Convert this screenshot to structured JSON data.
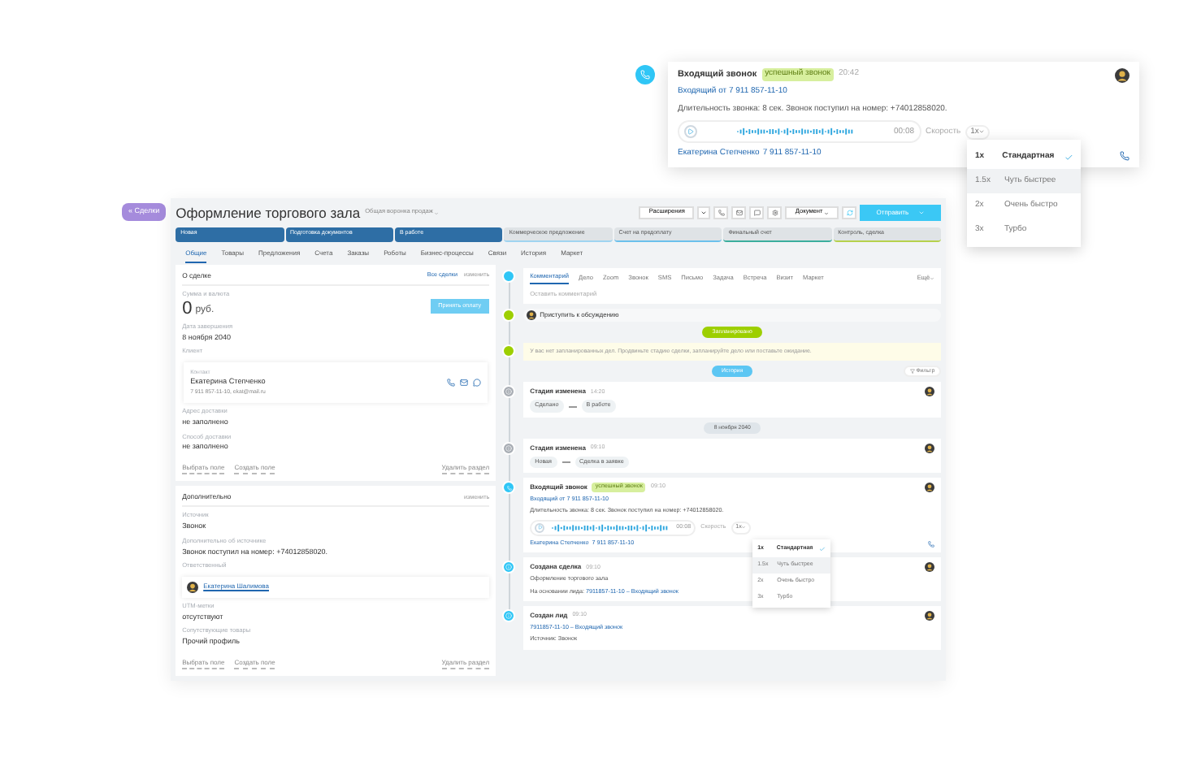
{
  "call_popup": {
    "title": "Входящий звонок",
    "badge": "успешный звонок",
    "time": "20:42",
    "link": "Входящий от 7 911 857-11-10",
    "details": "Длительность звонка: 8 сек. Звонок поступил на номер: +74012858020.",
    "duration": "00:08",
    "speed_label": "Скорость",
    "speed_value": "1x",
    "contact": "Екатерина Степченко",
    "phone": "7 911 857-11-10",
    "speed_menu": [
      {
        "rate": "1x",
        "label": "Стандартная",
        "selected": true,
        "highlighted": false
      },
      {
        "rate": "1.5x",
        "label": "Чуть быстрее",
        "selected": false,
        "highlighted": true
      },
      {
        "rate": "2x",
        "label": "Очень быстро",
        "selected": false,
        "highlighted": false
      },
      {
        "rate": "3x",
        "label": "Турбо",
        "selected": false,
        "highlighted": false
      }
    ]
  },
  "deal": {
    "back": "« Сделки",
    "title": "Оформление торгового зала",
    "funnel": "Общая воронка продаж",
    "toolbar": {
      "extensions": "Расширения",
      "document": "Документ",
      "primary": "Отправить"
    },
    "stages": [
      {
        "label": "Новая",
        "done": true,
        "color": "#2e6ea5"
      },
      {
        "label": "Подготовка документов",
        "done": true,
        "color": "#2e6ea5"
      },
      {
        "label": "В работе",
        "done": true,
        "color": "#2e6ea5"
      },
      {
        "label": "Коммерческое предложение",
        "done": false,
        "color": "#9fd4f0"
      },
      {
        "label": "Счет на предоплату",
        "done": false,
        "color": "#6cc0ec"
      },
      {
        "label": "Финальный счет",
        "done": false,
        "color": "#3cae9d"
      },
      {
        "label": "Контроль, сделка",
        "done": false,
        "color": "#b6d14c"
      }
    ],
    "tabs": [
      {
        "label": "Общие",
        "selected": true
      },
      {
        "label": "Товары",
        "selected": false
      },
      {
        "label": "Предложения",
        "selected": false
      },
      {
        "label": "Счета",
        "selected": false
      },
      {
        "label": "Заказы",
        "selected": false
      },
      {
        "label": "Роботы",
        "selected": false
      },
      {
        "label": "Бизнес-процессы",
        "selected": false
      },
      {
        "label": "Связи",
        "selected": false
      },
      {
        "label": "История",
        "selected": false
      },
      {
        "label": "Маркет",
        "selected": false
      }
    ],
    "about": {
      "title": "О сделке",
      "all_deals": "Все сделки",
      "edit": "изменить",
      "amount_label": "Сумма и валюта",
      "amount": "0",
      "currency": "руб.",
      "pay_button": "Принять оплату",
      "date_label": "Дата завершения",
      "date": "8 ноября 2040",
      "client_label": "Клиент",
      "contact_label": "Контакт",
      "contact_name": "Екатерина Степченко",
      "contact_info": "7 911 857-11-10, ekat@mail.ru",
      "fields": [
        {
          "label": "Адрес доставки",
          "value": "не заполнено"
        },
        {
          "label": "Способ доставки",
          "value": "не заполнено"
        }
      ],
      "footer": [
        "Выбрать поле",
        "Создать поле"
      ],
      "remove": "Удалить раздел"
    },
    "extra": {
      "title": "Дополнительно",
      "edit": "изменить",
      "fields": [
        {
          "label": "Источник",
          "value": "Звонок"
        },
        {
          "label": "Дополнительно об источнике",
          "value": "Звонок поступил на номер: +74012858020."
        }
      ],
      "responsible_label": "Ответственный",
      "responsible": "Екатерина Шалимова",
      "fields_after": [
        {
          "label": "UTM-метки",
          "value": "отсутствуют"
        },
        {
          "label": "Сопутствующие товары",
          "value": "Прочий профиль"
        }
      ],
      "footer": [
        "Выбрать поле",
        "Создать поле"
      ],
      "remove": "Удалить раздел"
    },
    "feed": {
      "composer_tabs": [
        {
          "label": "Комментарий",
          "selected": true
        },
        {
          "label": "Дело",
          "selected": false
        },
        {
          "label": "Zoom",
          "selected": false
        },
        {
          "label": "Звонок",
          "selected": false
        },
        {
          "label": "SMS",
          "selected": false
        },
        {
          "label": "Письмо",
          "selected": false
        },
        {
          "label": "Задача",
          "selected": false
        },
        {
          "label": "Встреча",
          "selected": false
        },
        {
          "label": "Визит",
          "selected": false
        },
        {
          "label": "Маркет",
          "selected": false
        }
      ],
      "more": "Ещё",
      "placeholder": "Оставить комментарий",
      "planned_task": "Приступить к обсуждению",
      "planned_label": "Запланировано",
      "notice": "У вас нет запланированных дел. Продвиньте стадию сделки, запланируйте дело или поставьте ожидание.",
      "history_label": "История",
      "filter": "Фильтр",
      "entries": [
        {
          "kind": "stage",
          "title": "Стадия изменена",
          "time": "14:20",
          "from": "Сделано",
          "to": "В работе"
        },
        {
          "kind": "date",
          "title": "8 ноября 2040"
        },
        {
          "kind": "stage",
          "title": "Стадия изменена",
          "time": "09:10",
          "from": "Новая",
          "to": "Сделка в заявке"
        },
        {
          "kind": "call",
          "title": "Входящий звонок",
          "badge": "успешный звонок",
          "time": "09:10",
          "link": "Входящий от 7 911 857-11-10",
          "details": "Длительность звонка: 8 сек. Звонок поступил на номер: +74012858020.",
          "duration": "00:08",
          "speed_label": "Скорость",
          "speed_value": "1x",
          "contact": "Екатерина Степченко",
          "phone": "7 911 857-11-10",
          "speed_menu": [
            {
              "rate": "1x",
              "label": "Стандартная",
              "selected": true,
              "highlighted": false
            },
            {
              "rate": "1.5x",
              "label": "Чуть быстрее",
              "selected": false,
              "highlighted": true
            },
            {
              "rate": "2x",
              "label": "Очень быстро",
              "selected": false,
              "highlighted": false
            },
            {
              "rate": "3x",
              "label": "Турбо",
              "selected": false,
              "highlighted": false
            }
          ]
        },
        {
          "kind": "deal",
          "title": "Создана сделка",
          "time": "09:10",
          "text": "Оформление торгового зала",
          "link_label": "На основании лида:",
          "link": "7911857-11-10 – Входящий звонок"
        },
        {
          "kind": "lead",
          "title": "Создан лид",
          "time": "09:10",
          "link": "7911857-11-10 – Входящий звонок",
          "text": "Источник: Звонок"
        }
      ]
    }
  }
}
